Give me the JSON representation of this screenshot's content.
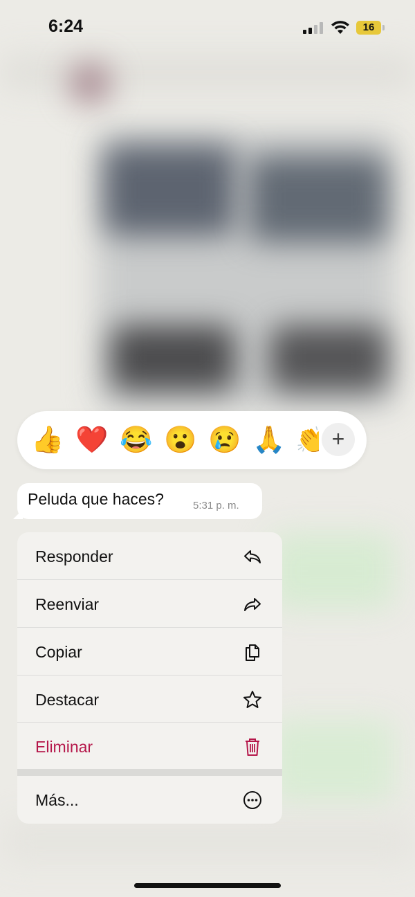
{
  "status_bar": {
    "time": "6:24",
    "battery": "16"
  },
  "reactions": {
    "emojis": [
      "👍",
      "❤️",
      "😂",
      "😮",
      "😢",
      "🙏",
      "👏"
    ],
    "add_symbol": "+"
  },
  "message": {
    "text": "Peluda que haces?",
    "time": "5:31 p. m."
  },
  "menu": {
    "items": [
      {
        "label": "Responder",
        "icon": "reply-icon"
      },
      {
        "label": "Reenviar",
        "icon": "forward-icon"
      },
      {
        "label": "Copiar",
        "icon": "copy-icon"
      },
      {
        "label": "Destacar",
        "icon": "star-icon"
      },
      {
        "label": "Eliminar",
        "icon": "trash-icon"
      },
      {
        "label": "Más...",
        "icon": "more-icon"
      }
    ]
  },
  "colors": {
    "danger": "#b5174a",
    "battery": "#e7c83a"
  }
}
